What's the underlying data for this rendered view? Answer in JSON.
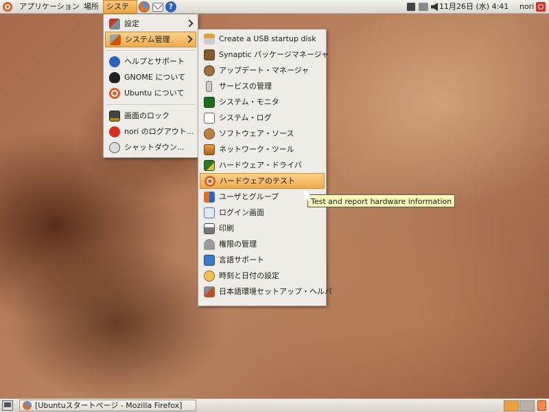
{
  "top_panel": {
    "applications": "アプリケーション",
    "places": "場所",
    "system": "システム",
    "help_icon_glyph": "?",
    "clock": "11月26日 (水)  4:41",
    "user": "nori"
  },
  "system_menu": {
    "items": [
      {
        "label": "設定",
        "icon": "preferences-icon",
        "submenu": true
      },
      {
        "label": "システム管理",
        "icon": "administration-icon",
        "submenu": true
      },
      {
        "label": "ヘルプとサポート",
        "icon": "help-icon"
      },
      {
        "label": "GNOME について",
        "icon": "gnome-icon"
      },
      {
        "label": "Ubuntu について",
        "icon": "ubuntu-icon"
      },
      {
        "label": "画面のロック",
        "icon": "lock-screen-icon"
      },
      {
        "label": "nori のログアウト...",
        "icon": "logout-icon"
      },
      {
        "label": "シャットダウン...",
        "icon": "shutdown-icon"
      }
    ]
  },
  "admin_menu": {
    "items": [
      {
        "label": "Create a USB startup disk",
        "icon": "usb-disk-icon"
      },
      {
        "label": "Synaptic パッケージマネージャ",
        "icon": "synaptic-icon"
      },
      {
        "label": "アップデート・マネージャ",
        "icon": "update-manager-icon"
      },
      {
        "label": "サービスの管理",
        "icon": "services-icon"
      },
      {
        "label": "システム・モニタ",
        "icon": "system-monitor-icon"
      },
      {
        "label": "システム・ログ",
        "icon": "system-log-icon"
      },
      {
        "label": "ソフトウェア・ソース",
        "icon": "software-sources-icon"
      },
      {
        "label": "ネットワーク・ツール",
        "icon": "network-tools-icon"
      },
      {
        "label": "ハードウェア・ドライバ",
        "icon": "hardware-drivers-icon"
      },
      {
        "label": "ハードウェアのテスト",
        "icon": "hardware-test-icon"
      },
      {
        "label": "ユーザとグループ",
        "icon": "users-groups-icon"
      },
      {
        "label": "ログイン画面",
        "icon": "login-window-icon"
      },
      {
        "label": "印刷",
        "icon": "printing-icon"
      },
      {
        "label": "権限の管理",
        "icon": "authorizations-icon"
      },
      {
        "label": "言語サポート",
        "icon": "language-support-icon"
      },
      {
        "label": "時刻と日付の設定",
        "icon": "time-date-icon"
      },
      {
        "label": "日本語環境セットアップ・ヘルパ",
        "icon": "japanese-setup-icon"
      }
    ]
  },
  "tooltip": "Test and report hardware information",
  "bottom_panel": {
    "task": "[Ubuntuスタートページ - Mozilla Firefox]"
  },
  "colors": {
    "highlight": "#eeac4c",
    "menu_bg": "#efebe7",
    "tooltip_bg": "#f7f7b8"
  }
}
